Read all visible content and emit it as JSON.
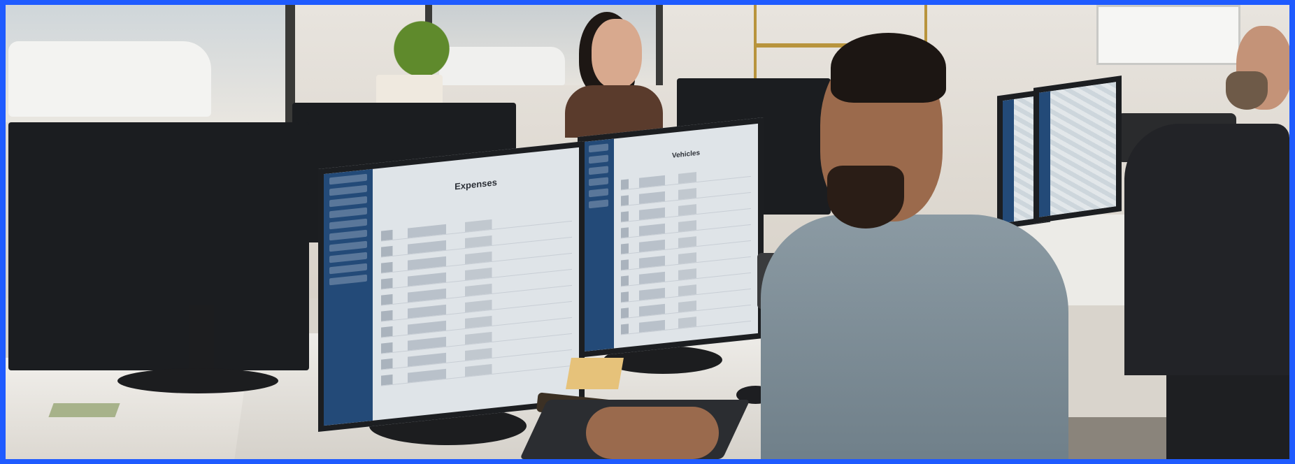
{
  "scene": {
    "description_kind": "photo",
    "border_color": "#1f5bff"
  },
  "screens": {
    "expenses": {
      "title": "Expenses"
    },
    "vehicles": {
      "title": "Vehicles"
    }
  },
  "icons": {
    "sidebar": "sidebar-nav-icon"
  }
}
